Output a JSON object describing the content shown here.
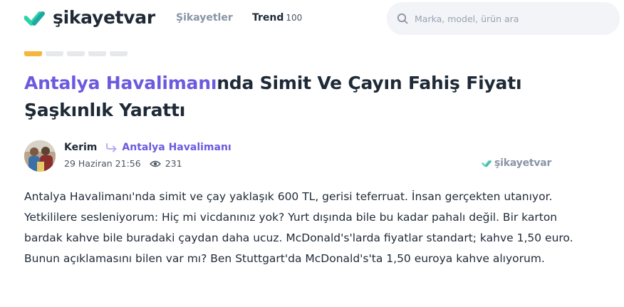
{
  "header": {
    "logo_text": "şikayetvar",
    "nav": {
      "complaints_label": "Şikayetler",
      "trend_label": "Trend",
      "trend_count": "100"
    },
    "search": {
      "placeholder": "Marka, model, ürün ara",
      "icon": "search-icon"
    }
  },
  "rating": {
    "total": 5,
    "filled": 1,
    "active_color": "#f4b63c"
  },
  "complaint": {
    "title_brand": "Antalya Havalimanı",
    "title_rest": "nda Simit Ve Çayın Fahiş Fiyatı Şaşkınlık Yarattı",
    "author": "Kerim",
    "company": "Antalya Havalimanı",
    "date": "29 Haziran 21:56",
    "views": "231",
    "watermark": "şikayetvar",
    "body": "Antalya Havalimanı'nda simit ve çay yaklaşık 600 TL, gerisi teferruat. İnsan gerçekten utanıyor. Yetkililere sesleniyorum: Hiç mi vicdanınız yok? Yurt dışında bile bu kadar pahalı değil. Bir karton bardak kahve bile buradaki çaydan daha ucuz. McDonald's'larda fiyatlar standart; kahve 1,50 euro. Bunun açıklamasını bilen var mı? Ben Stuttgart'da McDonald's'ta 1,50 euroya kahve alıyorum."
  },
  "colors": {
    "brand_purple": "#6b5ae0",
    "logo_green": "#2ad3a8",
    "text_dark": "#1f2a37"
  }
}
